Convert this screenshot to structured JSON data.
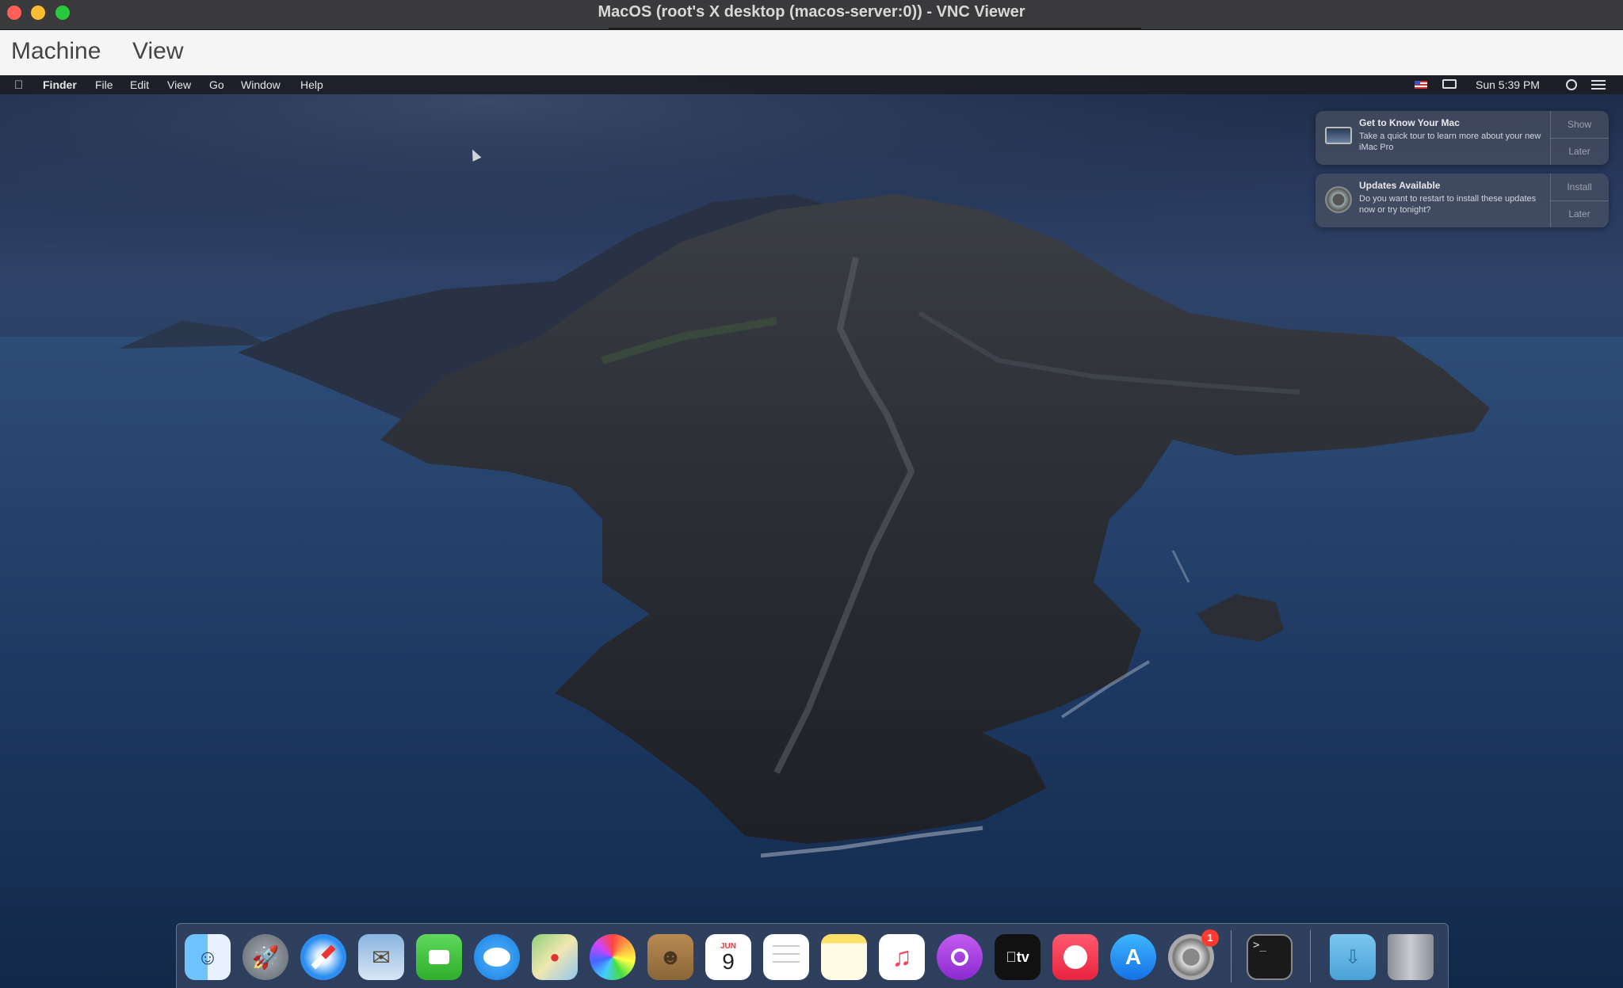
{
  "vnc_window": {
    "title": "MacOS (root's X desktop (macos-server:0)) - VNC Viewer",
    "menu": [
      "Machine",
      "View"
    ]
  },
  "mac_menubar": {
    "apple_icon": "apple-icon",
    "items": [
      "Finder",
      "File",
      "Edit",
      "View",
      "Go",
      "Window",
      "Help"
    ],
    "clock": "Sun 5:39 PM",
    "status_icons": [
      "us-flag-icon",
      "airplay-display-icon",
      "spotlight-search-icon",
      "notification-center-icon"
    ]
  },
  "notifications": [
    {
      "title": "Get to Know Your Mac",
      "body": "Take a quick tour to learn more about your new iMac Pro",
      "actions": [
        "Show",
        "Later"
      ],
      "icon": "imac-icon"
    },
    {
      "title": "Updates Available",
      "body": "Do you want to restart to install these updates now or try tonight?",
      "actions": [
        "Install",
        "Later"
      ],
      "icon": "software-update-gear-icon"
    }
  ],
  "dock": {
    "apps": [
      "finder-icon",
      "launchpad-icon",
      "safari-icon",
      "mail-icon",
      "facetime-icon",
      "messages-icon",
      "maps-icon",
      "photos-icon",
      "contacts-icon",
      "calendar-icon",
      "reminders-icon",
      "notes-icon",
      "music-icon",
      "podcasts-icon",
      "apple-tv-icon",
      "news-icon",
      "app-store-icon",
      "system-preferences-icon"
    ],
    "system_preferences_badge": "1",
    "calendar_day": "9",
    "calendar_month": "JUN",
    "tv_label": "tv",
    "others": [
      "terminal-icon",
      "downloads-folder-icon",
      "trash-icon"
    ]
  },
  "colors": {
    "title_bar": "#3a3a3c",
    "vnc_menubar": "#f5f5f5",
    "badge": "#ff3b30"
  }
}
